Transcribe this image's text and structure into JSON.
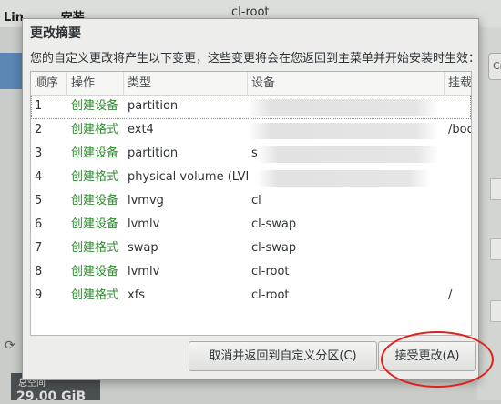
{
  "background": {
    "title_left": "Lin         安装",
    "title_right": "cl-root",
    "right_button": "Cr",
    "refresh_icon": "refresh-icon",
    "free_space_label": "总空间",
    "free_space_value": "29.00 GiB"
  },
  "dialog": {
    "title": "更改摘要",
    "description": "您的自定义更改将产生以下变更，这些变更将会在您返回到主菜单并开始安装时生效：",
    "columns": [
      "顺序",
      "操作",
      "类型",
      "设备",
      "挂载点"
    ],
    "rows": [
      {
        "order": "1",
        "action": "创建设备",
        "type": "partition",
        "device": "",
        "mount": ""
      },
      {
        "order": "2",
        "action": "创建格式",
        "type": "ext4",
        "device": "",
        "mount": "/boot"
      },
      {
        "order": "3",
        "action": "创建设备",
        "type": "partition",
        "device": "s",
        "mount": ""
      },
      {
        "order": "4",
        "action": "创建格式",
        "type": "physical volume (LVM)",
        "device": "",
        "mount": ""
      },
      {
        "order": "5",
        "action": "创建设备",
        "type": "lvmvg",
        "device": "cl",
        "mount": ""
      },
      {
        "order": "6",
        "action": "创建设备",
        "type": "lvmlv",
        "device": "cl-swap",
        "mount": ""
      },
      {
        "order": "7",
        "action": "创建格式",
        "type": "swap",
        "device": "cl-swap",
        "mount": ""
      },
      {
        "order": "8",
        "action": "创建设备",
        "type": "lvmlv",
        "device": "cl-root",
        "mount": ""
      },
      {
        "order": "9",
        "action": "创建格式",
        "type": "xfs",
        "device": "cl-root",
        "mount": "/"
      }
    ],
    "cancel_button": "取消并返回到自定义分区(C)",
    "accept_button": "接受更改(A)"
  },
  "colors": {
    "action_green": "#2e8b2e",
    "annotation_red": "#e0201c"
  }
}
